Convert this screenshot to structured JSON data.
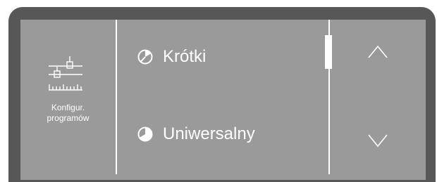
{
  "left_panel": {
    "icon": "program-settings-sliders-icon",
    "label_line1": "Konfigur.",
    "label_line2": "programów"
  },
  "program_list": {
    "items": [
      {
        "icon": "pie-short-icon",
        "label": "Krótki"
      },
      {
        "icon": "pie-universal-icon",
        "label": "Uniwersalny"
      }
    ]
  },
  "scroll": {
    "up_icon": "chevron-up-icon",
    "down_icon": "chevron-down-icon"
  },
  "colors": {
    "bezel": "#575757",
    "screen": "#9a9a9a",
    "foreground": "#ffffff"
  }
}
